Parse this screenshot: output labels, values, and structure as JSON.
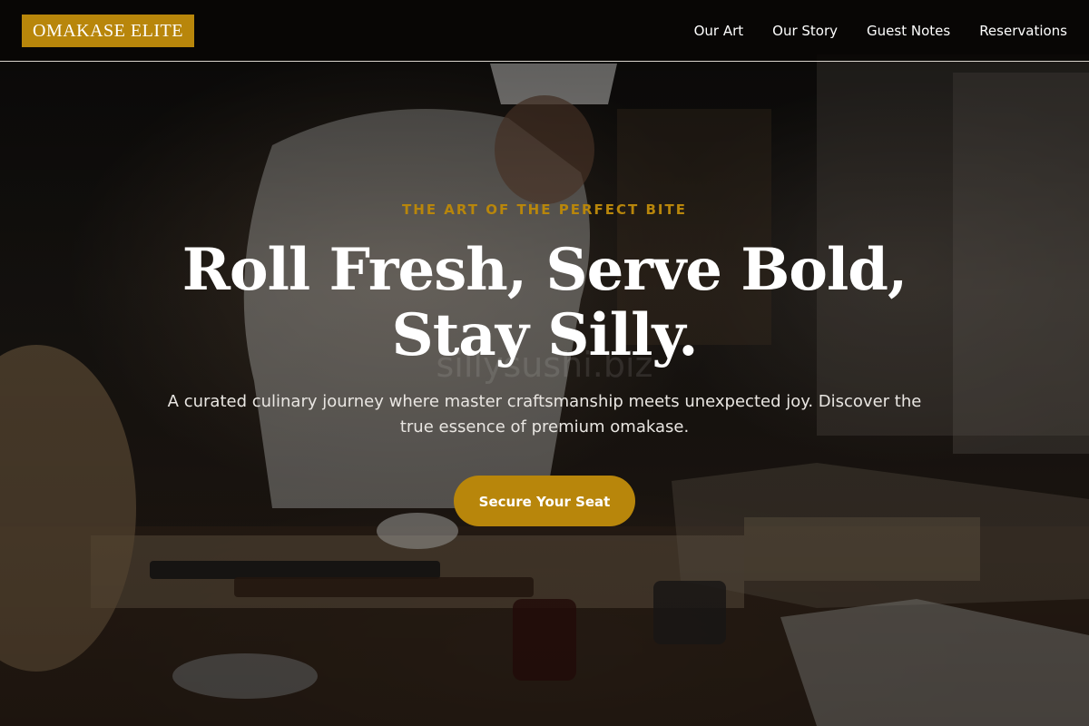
{
  "brand": {
    "logo_text": "OMAKASE ELITE",
    "accent_color": "#b8860b"
  },
  "nav": {
    "items": [
      {
        "label": "Our Art"
      },
      {
        "label": "Our Story"
      },
      {
        "label": "Guest Notes"
      },
      {
        "label": "Reservations"
      }
    ]
  },
  "hero": {
    "eyebrow": "THE ART OF THE PERFECT BITE",
    "headline_line1": "Roll Fresh, Serve Bold,",
    "headline_line2": "Stay Silly.",
    "watermark": "sillysushi.biz",
    "subtext": "A curated culinary journey where master craftsmanship meets unexpected joy. Discover the true essence of premium omakase.",
    "cta_label": "Secure Your Seat"
  }
}
